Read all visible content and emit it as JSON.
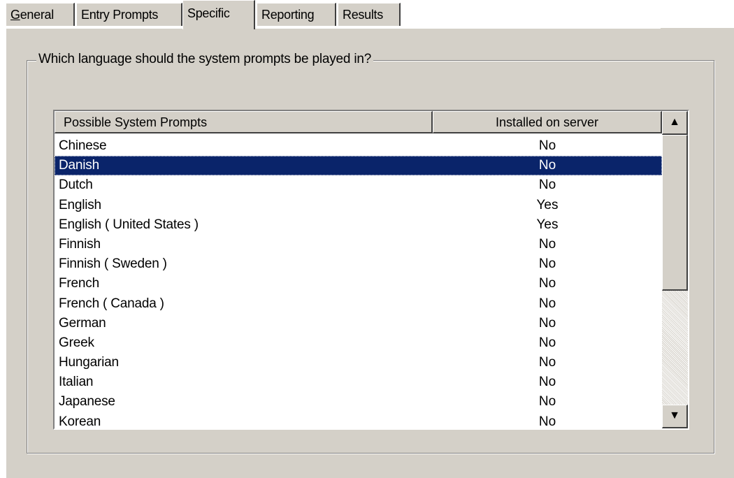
{
  "tabs": [
    {
      "label_first": "G",
      "label_rest": "eneral"
    },
    {
      "label": "Entry Prompts"
    },
    {
      "label": "Specific"
    },
    {
      "label": "Reporting"
    },
    {
      "label": "Results"
    }
  ],
  "group": {
    "legend": "Which language should the system prompts be played in?"
  },
  "list": {
    "columns": [
      "Possible System Prompts",
      "Installed on server"
    ],
    "rows": [
      {
        "name": "Chinese",
        "installed": "No"
      },
      {
        "name": "Danish",
        "installed": "No"
      },
      {
        "name": "Dutch",
        "installed": "No"
      },
      {
        "name": "English",
        "installed": "Yes"
      },
      {
        "name": "English  ( United States )",
        "installed": "Yes"
      },
      {
        "name": "Finnish",
        "installed": "No"
      },
      {
        "name": "Finnish  ( Sweden )",
        "installed": "No"
      },
      {
        "name": "French",
        "installed": "No"
      },
      {
        "name": "French  ( Canada )",
        "installed": "No"
      },
      {
        "name": "German",
        "installed": "No"
      },
      {
        "name": "Greek",
        "installed": "No"
      },
      {
        "name": "Hungarian",
        "installed": "No"
      },
      {
        "name": "Italian",
        "installed": "No"
      },
      {
        "name": "Japanese",
        "installed": "No"
      },
      {
        "name": "Korean",
        "installed": "No"
      }
    ]
  },
  "scrollbar": {
    "up_icon": "▲",
    "down_icon": "▼"
  },
  "colors": {
    "selection": "#0a246a",
    "face": "#d4d0c8"
  }
}
